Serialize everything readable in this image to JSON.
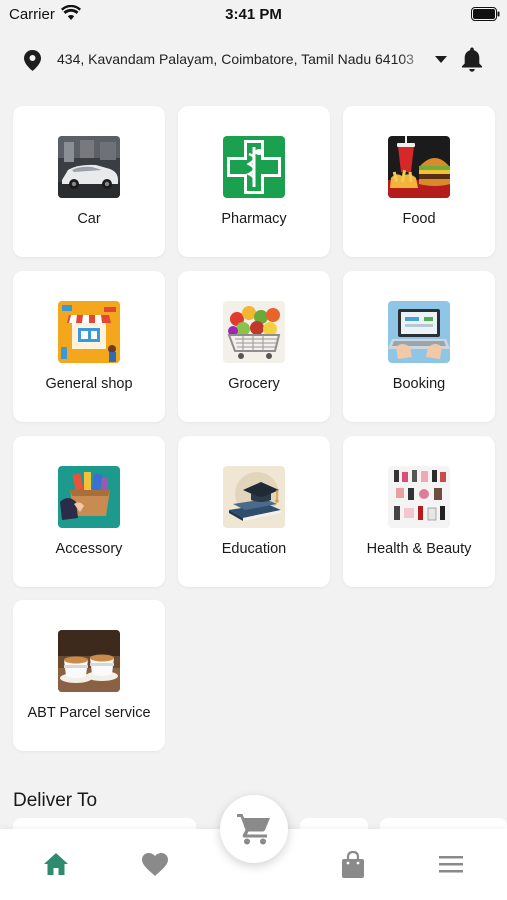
{
  "status": {
    "carrier": "Carrier",
    "time": "3:41 PM"
  },
  "location": {
    "address": "434, Kavandam Palayam, Coimbatore, Tamil Nadu 64103"
  },
  "categories": [
    {
      "label": "Car",
      "icon": "car-photo-icon"
    },
    {
      "label": "Pharmacy",
      "icon": "pharmacy-cross-icon"
    },
    {
      "label": "Food",
      "icon": "burger-fries-icon"
    },
    {
      "label": "General shop",
      "icon": "storefront-icon"
    },
    {
      "label": "Grocery",
      "icon": "grocery-cart-icon"
    },
    {
      "label": "Booking",
      "icon": "laptop-booking-icon"
    },
    {
      "label": "Accessory",
      "icon": "accessory-box-icon"
    },
    {
      "label": "Education",
      "icon": "graduation-cap-icon"
    },
    {
      "label": "Health & Beauty",
      "icon": "cosmetics-icon"
    },
    {
      "label": "ABT Parcel service",
      "icon": "coffee-cups-icon"
    }
  ],
  "deliver": {
    "title": "Deliver To"
  },
  "nav": {
    "active": "home",
    "accent": "#2e8b6e",
    "inactive": "#8a8a8a"
  }
}
